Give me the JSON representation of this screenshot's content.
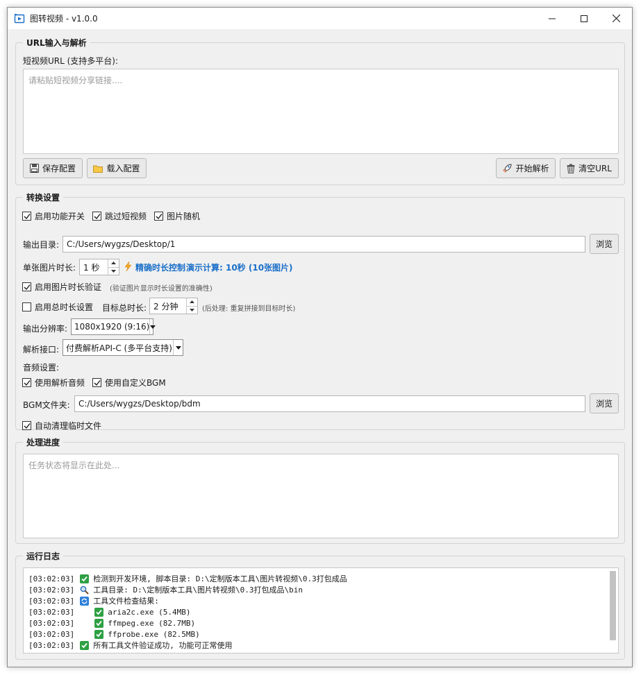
{
  "window": {
    "title": "图转视频 - v1.0.0",
    "minimize_icon": "minimize-icon",
    "maximize_icon": "maximize-icon",
    "close_icon": "close-icon"
  },
  "url_section": {
    "title": "URL输入与解析",
    "field_label": "短视频URL (支持多平台):",
    "placeholder": "请粘贴短视频分享链接....",
    "save_config": "保存配置",
    "load_config": "载入配置",
    "start_parse": "开始解析",
    "clear_url": "清空URL"
  },
  "convert_section": {
    "title": "转换设置",
    "enable_feature": "启用功能开关",
    "skip_short_video": "跳过短视频",
    "random_image": "图片随机",
    "output_dir_label": "输出目录:",
    "output_dir_value": "C:/Users/wygzs/Desktop/1",
    "browse": "浏览",
    "single_duration_label": "单张图片时长:",
    "single_duration_value": "1 秒",
    "precise_control": "精确时长控制",
    "demo_calc": "演示计算: 10秒 (10张图片)",
    "enable_duration_verify": "启用图片时长验证",
    "duration_verify_hint": "(验证图片显示时长设置的准确性)",
    "enable_total_duration": "启用总时长设置",
    "target_total_label": "目标总时长:",
    "target_total_value": "2 分钟",
    "post_process_hint": "(后处理: 重复拼接到目标时长)",
    "resolution_label": "输出分辨率:",
    "resolution_value": "1080x1920 (9:16)",
    "api_label": "解析接口:",
    "api_value": "付费解析API-C (多平台支持)",
    "audio_label": "音频设置:",
    "use_parsed_audio": "使用解析音频",
    "use_custom_bgm": "使用自定义BGM",
    "bgm_label": "BGM文件夹:",
    "bgm_value": "C:/Users/wygzs/Desktop/bdm",
    "bgm_browse": "浏览",
    "auto_clean": "自动清理临时文件"
  },
  "progress_section": {
    "title": "处理进度",
    "placeholder": "任务状态将显示在此处..."
  },
  "log_section": {
    "title": "运行日志",
    "lines": [
      {
        "time": "[03:02:03]",
        "icon": "check-icon",
        "indent": 0,
        "text": "检测到开发环境, 脚本目录: D:\\定制版本工具\\图片转视频\\0.3打包成品"
      },
      {
        "time": "[03:02:03]",
        "icon": "magnifier-icon",
        "indent": 0,
        "text": "工具目录: D:\\定制版本工具\\图片转视频\\0.3打包成品\\bin"
      },
      {
        "time": "[03:02:03]",
        "icon": "refresh-icon",
        "indent": 0,
        "text": "工具文件检查结果:"
      },
      {
        "time": "[03:02:03]",
        "icon": "check-icon",
        "indent": 1,
        "text": "aria2c.exe (5.4MB)"
      },
      {
        "time": "[03:02:03]",
        "icon": "check-icon",
        "indent": 1,
        "text": "ffmpeg.exe (82.7MB)"
      },
      {
        "time": "[03:02:03]",
        "icon": "check-icon",
        "indent": 1,
        "text": "ffprobe.exe (82.5MB)"
      },
      {
        "time": "[03:02:03]",
        "icon": "check-icon",
        "indent": 0,
        "text": "所有工具文件验证成功, 功能可正常使用"
      }
    ]
  },
  "colors": {
    "accent_blue": "#1a6fc9",
    "check_green": "#2ea043",
    "window_bg": "#f0f0f0"
  }
}
